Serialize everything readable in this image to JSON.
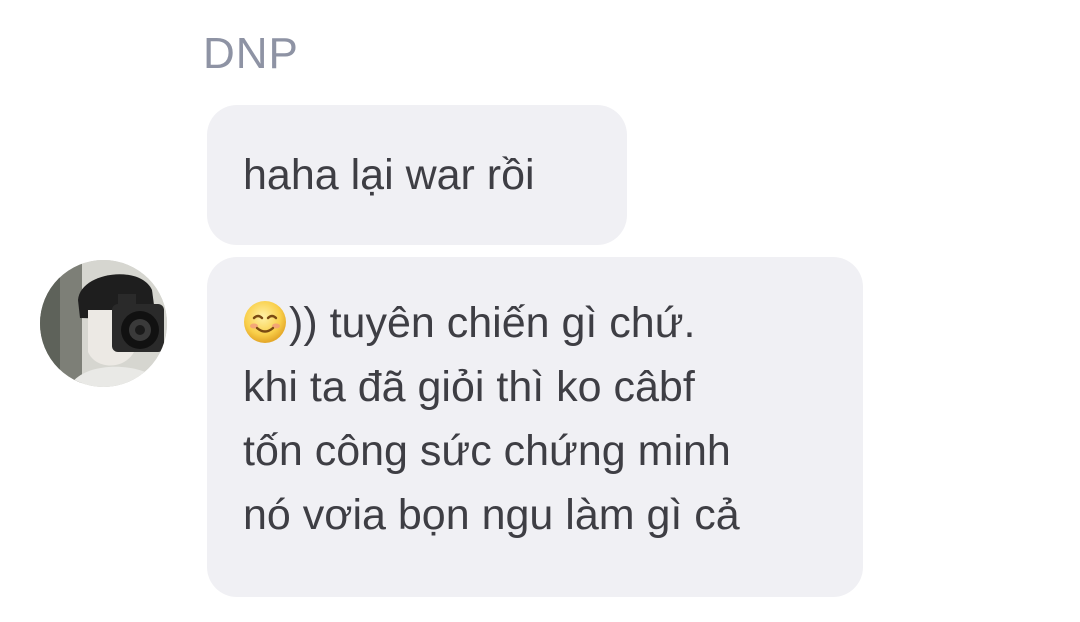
{
  "conversation": {
    "sender_name": "DNP",
    "messages": [
      {
        "lines": [
          "haha lại war rồi"
        ]
      },
      {
        "emoji": "smiling-face-icon",
        "lines": [
          ")) tuyên chiến gì chứ.",
          "khi ta đã giỏi thì ko câbf",
          "tốn công sức chứng minh",
          "nó vơia bọn ngu làm gì cả"
        ]
      }
    ],
    "avatar": "profile-photo-with-camera"
  }
}
